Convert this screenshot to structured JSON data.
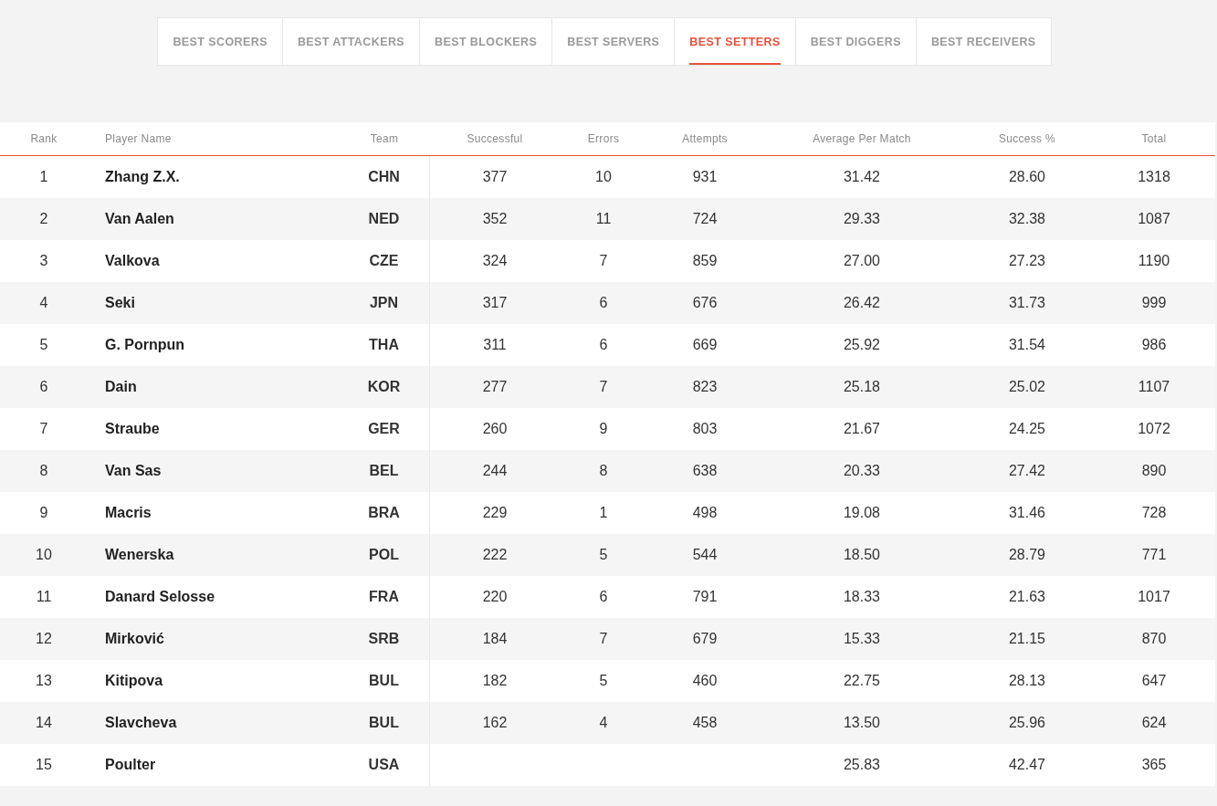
{
  "tabs": [
    {
      "label": "BEST SCORERS",
      "selected": false
    },
    {
      "label": "BEST ATTACKERS",
      "selected": false
    },
    {
      "label": "BEST BLOCKERS",
      "selected": false
    },
    {
      "label": "BEST SERVERS",
      "selected": false
    },
    {
      "label": "BEST SETTERS",
      "selected": true
    },
    {
      "label": "BEST DIGGERS",
      "selected": false
    },
    {
      "label": "BEST RECEIVERS",
      "selected": false
    }
  ],
  "table": {
    "columns": [
      "Rank",
      "Player Name",
      "Team",
      "Successful",
      "Errors",
      "Attempts",
      "Average Per Match",
      "Success %",
      "Total"
    ],
    "rows": [
      {
        "rank": "1",
        "player": "Zhang Z.X.",
        "team": "CHN",
        "successful": "377",
        "errors": "10",
        "attempts": "931",
        "average": "31.42",
        "success_pct": "28.60",
        "total": "1318"
      },
      {
        "rank": "2",
        "player": "Van Aalen",
        "team": "NED",
        "successful": "352",
        "errors": "11",
        "attempts": "724",
        "average": "29.33",
        "success_pct": "32.38",
        "total": "1087"
      },
      {
        "rank": "3",
        "player": "Valkova",
        "team": "CZE",
        "successful": "324",
        "errors": "7",
        "attempts": "859",
        "average": "27.00",
        "success_pct": "27.23",
        "total": "1190"
      },
      {
        "rank": "4",
        "player": "Seki",
        "team": "JPN",
        "successful": "317",
        "errors": "6",
        "attempts": "676",
        "average": "26.42",
        "success_pct": "31.73",
        "total": "999"
      },
      {
        "rank": "5",
        "player": "G. Pornpun",
        "team": "THA",
        "successful": "311",
        "errors": "6",
        "attempts": "669",
        "average": "25.92",
        "success_pct": "31.54",
        "total": "986"
      },
      {
        "rank": "6",
        "player": "Dain",
        "team": "KOR",
        "successful": "277",
        "errors": "7",
        "attempts": "823",
        "average": "25.18",
        "success_pct": "25.02",
        "total": "1107"
      },
      {
        "rank": "7",
        "player": "Straube",
        "team": "GER",
        "successful": "260",
        "errors": "9",
        "attempts": "803",
        "average": "21.67",
        "success_pct": "24.25",
        "total": "1072"
      },
      {
        "rank": "8",
        "player": "Van Sas",
        "team": "BEL",
        "successful": "244",
        "errors": "8",
        "attempts": "638",
        "average": "20.33",
        "success_pct": "27.42",
        "total": "890"
      },
      {
        "rank": "9",
        "player": "Macris",
        "team": "BRA",
        "successful": "229",
        "errors": "1",
        "attempts": "498",
        "average": "19.08",
        "success_pct": "31.46",
        "total": "728"
      },
      {
        "rank": "10",
        "player": "Wenerska",
        "team": "POL",
        "successful": "222",
        "errors": "5",
        "attempts": "544",
        "average": "18.50",
        "success_pct": "28.79",
        "total": "771"
      },
      {
        "rank": "11",
        "player": "Danard Selosse",
        "team": "FRA",
        "successful": "220",
        "errors": "6",
        "attempts": "791",
        "average": "18.33",
        "success_pct": "21.63",
        "total": "1017"
      },
      {
        "rank": "12",
        "player": "Mirković",
        "team": "SRB",
        "successful": "184",
        "errors": "7",
        "attempts": "679",
        "average": "15.33",
        "success_pct": "21.15",
        "total": "870"
      },
      {
        "rank": "13",
        "player": "Kitipova",
        "team": "BUL",
        "successful": "182",
        "errors": "5",
        "attempts": "460",
        "average": "22.75",
        "success_pct": "28.13",
        "total": "647"
      },
      {
        "rank": "14",
        "player": "Slavcheva",
        "team": "BUL",
        "successful": "162",
        "errors": "4",
        "attempts": "458",
        "average": "13.50",
        "success_pct": "25.96",
        "total": "624"
      },
      {
        "rank": "15",
        "player": "Poulter",
        "team": "USA",
        "average": "25.83",
        "success_pct": "42.47",
        "total": "365"
      }
    ]
  }
}
